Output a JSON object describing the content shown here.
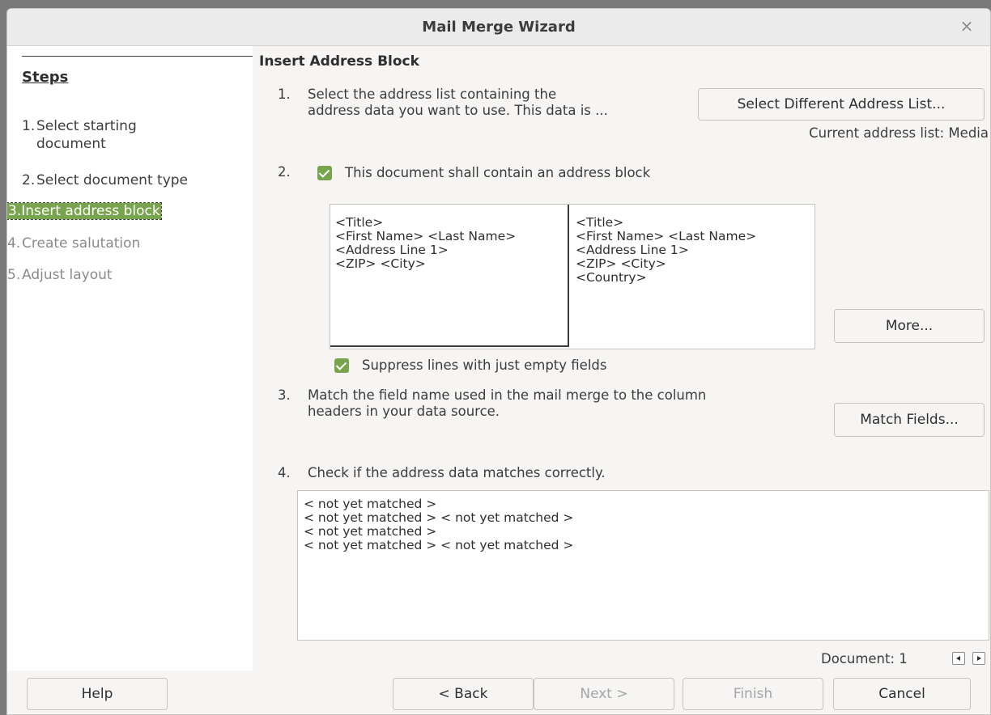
{
  "window": {
    "title": "Mail Merge Wizard",
    "close_glyph": "×"
  },
  "sidebar": {
    "title": "Steps",
    "steps": [
      {
        "num": "1.",
        "line1": "Select starting",
        "line2": "document",
        "state": "normal"
      },
      {
        "num": "2.",
        "label": "Select document type",
        "state": "normal"
      },
      {
        "num": "3.",
        "label": "Insert address block",
        "state": "active"
      },
      {
        "num": "4.",
        "label": "Create salutation",
        "state": "disabled"
      },
      {
        "num": "5.",
        "label": "Adjust layout",
        "state": "disabled"
      }
    ]
  },
  "main": {
    "title": "Insert Address Block",
    "step1": {
      "num": "1.",
      "line1": "Select the address list containing the",
      "line2": "address data you want to use. This data is ...",
      "button": "Select Different Address List...",
      "current_list": "Current address list: Media"
    },
    "step2": {
      "num": "2.",
      "checkbox_label": "This document shall contain an address block",
      "checked": true,
      "left_block": [
        "<Title>",
        "<First Name> <Last Name>",
        "<Address Line 1>",
        "<ZIP> <City>"
      ],
      "right_block": [
        "<Title>",
        "<First Name> <Last Name>",
        "<Address Line 1>",
        "<ZIP> <City>",
        "<Country>"
      ],
      "more_button": "More...",
      "suppress_label": "Suppress lines with just empty fields",
      "suppress_checked": true
    },
    "step3": {
      "num": "3.",
      "line1": "Match the field name used in the mail merge to the column",
      "line2": "headers in your data source.",
      "button": "Match Fields..."
    },
    "step4": {
      "num": "4.",
      "label": "Check if the address data matches correctly.",
      "preview": [
        "< not yet matched >",
        "< not yet matched > < not yet matched >",
        "< not yet matched >",
        "< not yet matched > < not yet matched >"
      ],
      "document_label": "Document: 1"
    }
  },
  "footer": {
    "help": "Help",
    "back": "< Back",
    "next": "Next >",
    "finish": "Finish",
    "cancel": "Cancel"
  },
  "colors": {
    "accent": "#78a44d",
    "sidebar_bg": "#ffffff",
    "window_bg": "#f6f5f4"
  }
}
